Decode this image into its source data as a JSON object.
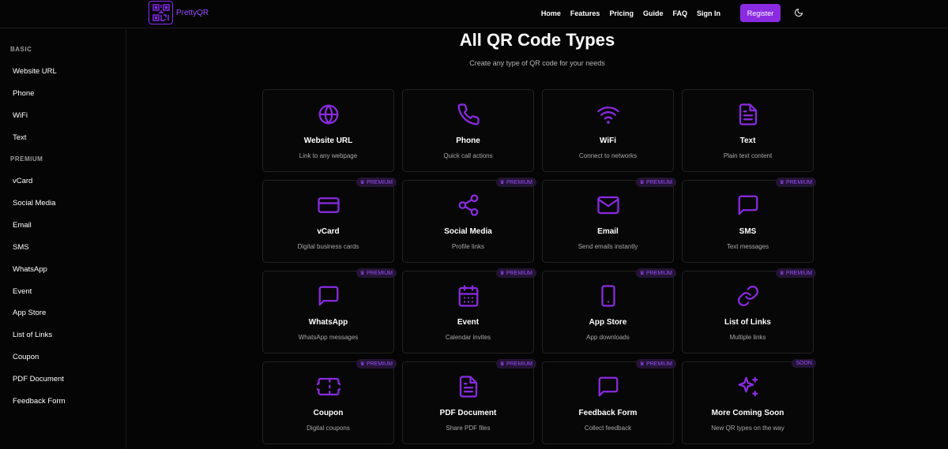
{
  "brand": {
    "name": "PrettyQR",
    "accent": "#8a2be2"
  },
  "nav": {
    "links": [
      "Home",
      "Features",
      "Pricing",
      "Guide",
      "FAQ",
      "Sign In"
    ],
    "register_label": "Register",
    "theme_icon": "moon-icon"
  },
  "sidebar": {
    "basic_heading": "BASIC",
    "basic_items": [
      "Website URL",
      "Phone",
      "WiFi",
      "Text"
    ],
    "premium_heading": "PREMIUM",
    "premium_items": [
      "vCard",
      "Social Media",
      "Email",
      "SMS",
      "WhatsApp",
      "Event",
      "App Store",
      "List of Links",
      "Coupon",
      "PDF Document",
      "Feedback Form"
    ]
  },
  "main": {
    "title": "All QR Code Types",
    "subtitle": "Create any type of QR code for your needs",
    "cards": [
      {
        "title": "Website URL",
        "desc": "Link to any webpage",
        "icon": "globe-icon",
        "badge": ""
      },
      {
        "title": "Phone",
        "desc": "Quick call actions",
        "icon": "phone-icon",
        "badge": ""
      },
      {
        "title": "WiFi",
        "desc": "Connect to networks",
        "icon": "wifi-icon",
        "badge": ""
      },
      {
        "title": "Text",
        "desc": "Plain text content",
        "icon": "document-icon",
        "badge": ""
      },
      {
        "title": "vCard",
        "desc": "Digital business cards",
        "icon": "card-icon",
        "badge": "PREMIUM"
      },
      {
        "title": "Social Media",
        "desc": "Profile links",
        "icon": "share-icon",
        "badge": "PREMIUM"
      },
      {
        "title": "Email",
        "desc": "Send emails instantly",
        "icon": "mail-icon",
        "badge": "PREMIUM"
      },
      {
        "title": "SMS",
        "desc": "Text messages",
        "icon": "chat-icon",
        "badge": "PREMIUM"
      },
      {
        "title": "WhatsApp",
        "desc": "WhatsApp messages",
        "icon": "chat-icon",
        "badge": "PREMIUM"
      },
      {
        "title": "Event",
        "desc": "Calendar invites",
        "icon": "calendar-icon",
        "badge": "PREMIUM"
      },
      {
        "title": "App Store",
        "desc": "App downloads",
        "icon": "mobile-icon",
        "badge": "PREMIUM"
      },
      {
        "title": "List of Links",
        "desc": "Multiple links",
        "icon": "link-icon",
        "badge": "PREMIUM"
      },
      {
        "title": "Coupon",
        "desc": "Digital coupons",
        "icon": "ticket-icon",
        "badge": "PREMIUM"
      },
      {
        "title": "PDF Document",
        "desc": "Share PDF files",
        "icon": "document-icon",
        "badge": "PREMIUM"
      },
      {
        "title": "Feedback Form",
        "desc": "Collect feedback",
        "icon": "chat-icon",
        "badge": "PREMIUM"
      },
      {
        "title": "More Coming Soon",
        "desc": "New QR types on the way",
        "icon": "sparkles-icon",
        "badge": "SOON"
      }
    ]
  }
}
